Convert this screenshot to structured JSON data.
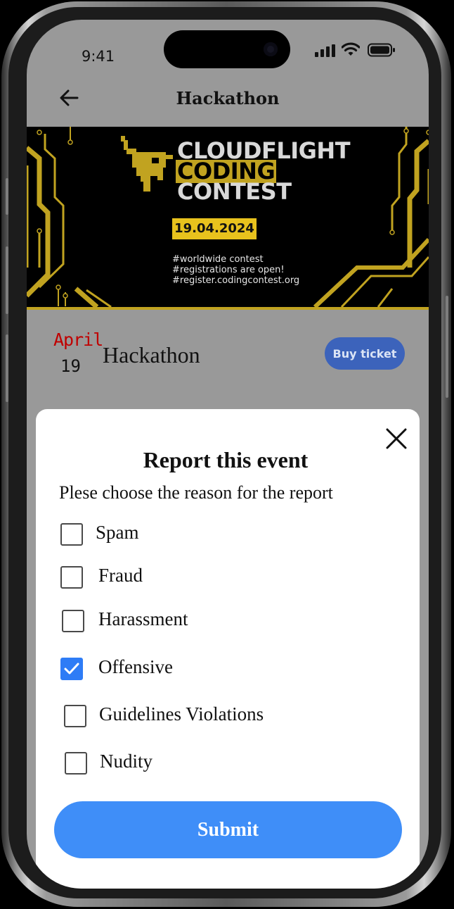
{
  "status_bar": {
    "time": "9:41"
  },
  "header": {
    "title": "Hackathon"
  },
  "banner": {
    "title_line1": "CLOUDFLIGHT",
    "title_line2": "CODING",
    "title_line3": "CONTEST",
    "date": "19.04.2024",
    "taglines": [
      "#worldwide contest",
      "#registrations are open!",
      "#register.codingcontest.org"
    ],
    "accent_color": "#c1a320"
  },
  "event": {
    "month": "April",
    "day": "19",
    "name": "Hackathon",
    "buy_label": "Buy ticket"
  },
  "report_modal": {
    "title": "Report this event",
    "subtitle": "Plese choose the reason for the report",
    "options": [
      {
        "label": "Spam",
        "checked": false
      },
      {
        "label": "Fraud",
        "checked": false
      },
      {
        "label": "Harassment",
        "checked": false
      },
      {
        "label": "Offensive",
        "checked": true
      },
      {
        "label": "Guidelines Violations",
        "checked": false
      },
      {
        "label": "Nudity",
        "checked": false
      }
    ],
    "submit_label": "Submit",
    "accent_color": "#3f8ef8"
  }
}
